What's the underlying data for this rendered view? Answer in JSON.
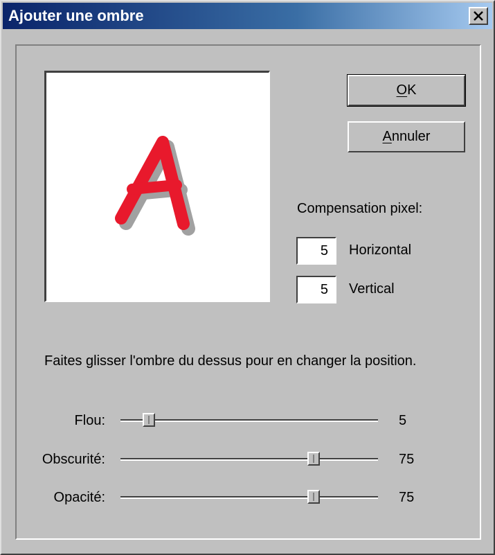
{
  "window": {
    "title": "Ajouter une ombre",
    "close_icon": "close-icon"
  },
  "preview": {
    "letter": "A",
    "letter_color": "#e8192c"
  },
  "buttons": {
    "ok_mnemonic": "O",
    "ok_rest": "K",
    "cancel_mnemonic": "A",
    "cancel_rest": "nnuler"
  },
  "offset": {
    "label": "Compensation pixel:",
    "horizontal_value": "5",
    "horizontal_label": "Horizontal",
    "vertical_value": "5",
    "vertical_label": "Vertical"
  },
  "hint": "Faites glisser l'ombre du dessus pour en changer la position.",
  "sliders": [
    {
      "label": "Flou:",
      "value": "5",
      "fraction": 0.11
    },
    {
      "label": "Obscurité:",
      "value": "75",
      "fraction": 0.75
    },
    {
      "label": "Opacité:",
      "value": "75",
      "fraction": 0.75
    }
  ]
}
